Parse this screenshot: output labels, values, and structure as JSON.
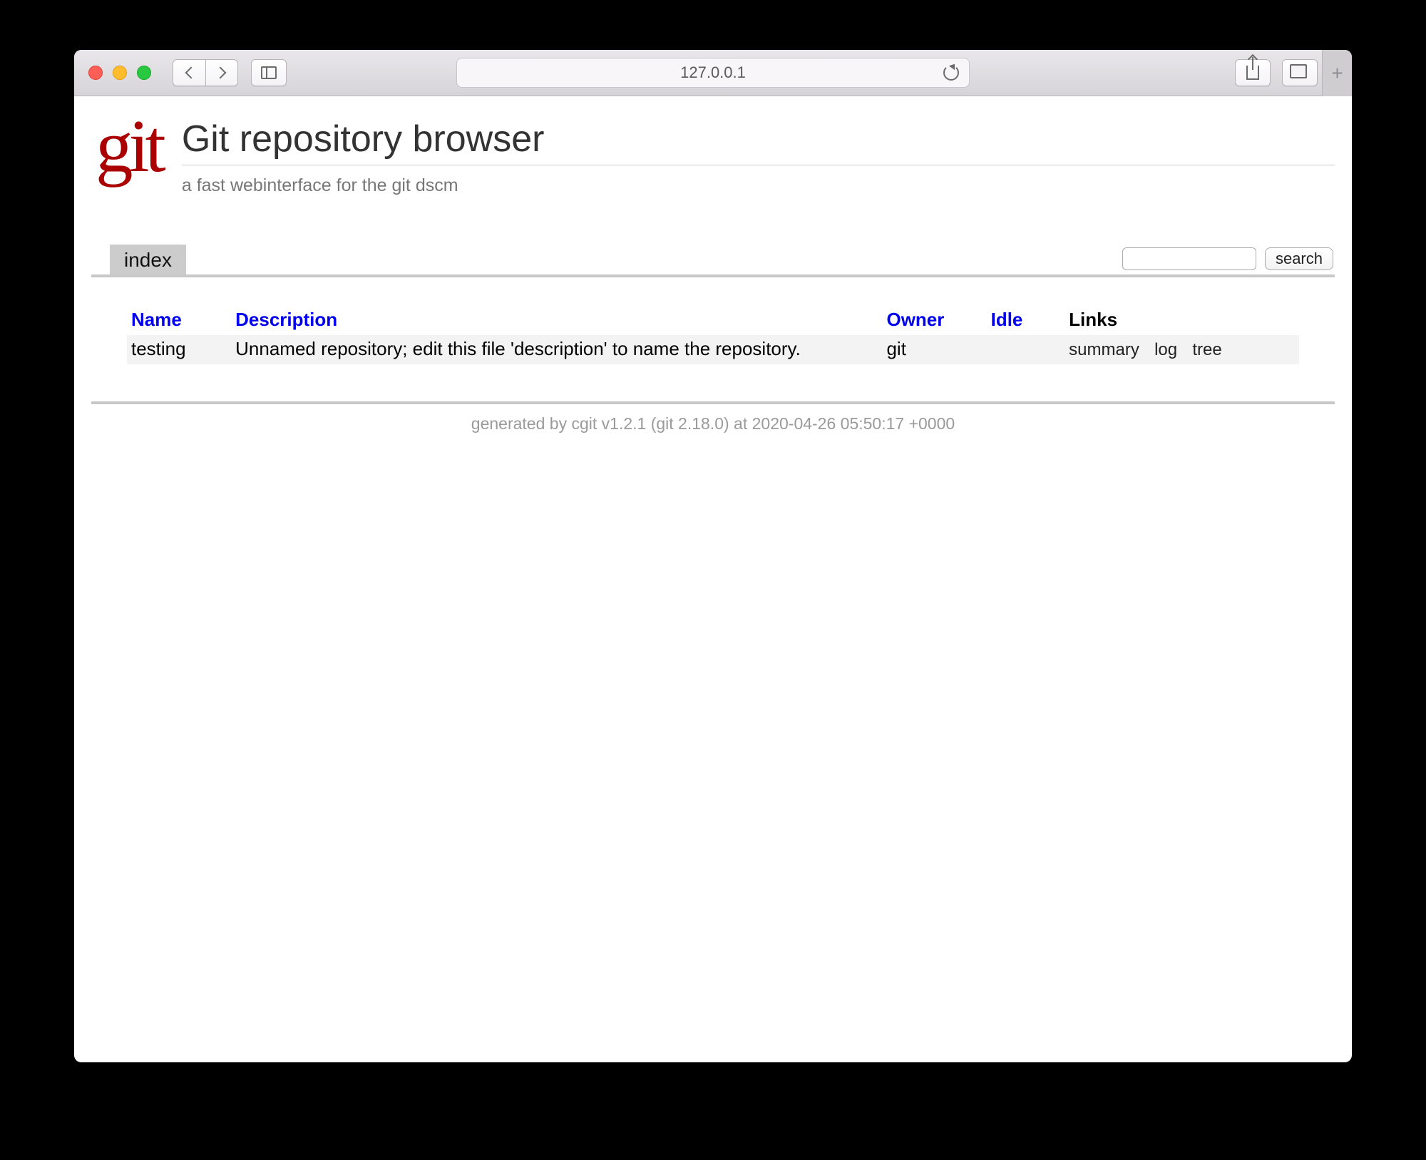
{
  "browser": {
    "address": "127.0.0.1",
    "new_tab_glyph": "+"
  },
  "page": {
    "logo_text": "git",
    "title": "Git repository browser",
    "subtitle": "a fast webinterface for the git dscm"
  },
  "tabs": {
    "index": "index"
  },
  "search": {
    "value": "",
    "button": "search"
  },
  "table": {
    "headers": {
      "name": "Name",
      "description": "Description",
      "owner": "Owner",
      "idle": "Idle",
      "links": "Links"
    },
    "rows": [
      {
        "name": "testing",
        "description": "Unnamed repository; edit this file 'description' to name the repository.",
        "owner": "git",
        "idle": "",
        "links": {
          "summary": "summary",
          "log": "log",
          "tree": "tree"
        }
      }
    ]
  },
  "footer": {
    "prefix": "generated by ",
    "cgit": "cgit v1.2.1",
    "git": " (git 2.18.0) ",
    "at": "at 2020-04-26 05:50:17 +0000"
  }
}
